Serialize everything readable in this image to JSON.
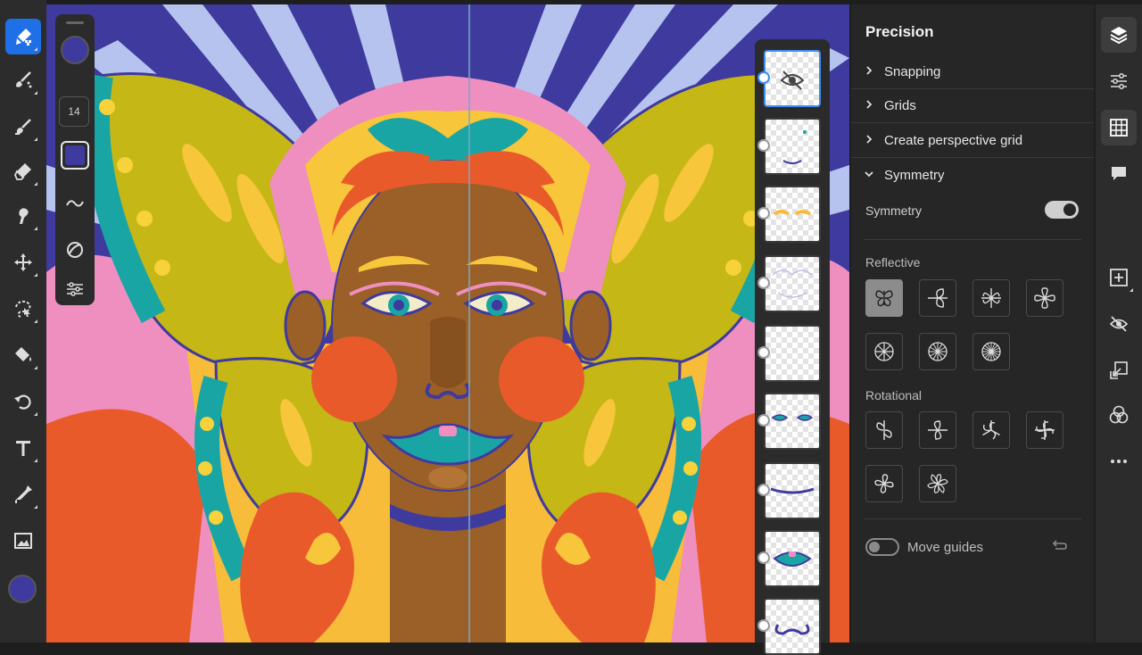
{
  "colors": {
    "accent": "#1f6fe6",
    "current_color": "#3f3a9e",
    "panel_bg": "#262626",
    "toolbar_bg": "#2c2c2c"
  },
  "left_toolbar": {
    "tools": [
      {
        "name": "pixel-brush-icon"
      },
      {
        "name": "live-brush-icon"
      },
      {
        "name": "vector-brush-icon"
      },
      {
        "name": "eraser-icon"
      },
      {
        "name": "smudge-icon"
      },
      {
        "name": "move-icon"
      },
      {
        "name": "lasso-icon"
      },
      {
        "name": "fill-icon"
      },
      {
        "name": "transform-icon"
      },
      {
        "name": "text-icon"
      },
      {
        "name": "eyedropper-icon"
      },
      {
        "name": "image-icon"
      }
    ]
  },
  "brush_panel": {
    "size_value": "14",
    "icons": [
      "smoothing-icon",
      "pressure-icon",
      "brush-settings-icon"
    ]
  },
  "layers_panel": {
    "layers": [
      {
        "name": "layer-eye",
        "hidden": true,
        "selected": true
      },
      {
        "name": "layer-face-details"
      },
      {
        "name": "layer-brows"
      },
      {
        "name": "layer-lines"
      },
      {
        "name": "layer-empty"
      },
      {
        "name": "layer-eyes"
      },
      {
        "name": "layer-mouth-line"
      },
      {
        "name": "layer-lips"
      },
      {
        "name": "layer-nose"
      }
    ]
  },
  "precision_panel": {
    "title": "Precision",
    "sections": {
      "snapping": "Snapping",
      "grids": "Grids",
      "perspective": "Create perspective grid",
      "symmetry": "Symmetry"
    },
    "symmetry_toggle_label": "Symmetry",
    "symmetry_enabled": true,
    "reflective_label": "Reflective",
    "reflective_options": [
      "butterfly-2fold",
      "leaf-horizontal",
      "butterfly-4fold",
      "flower-4fold",
      "radial-8",
      "radial-12",
      "radial-16"
    ],
    "rotational_label": "Rotational",
    "rotational_options": [
      "rot-2fold",
      "rot-leaf",
      "rot-3fold",
      "rot-4fold",
      "rot-5fold",
      "rot-6fold"
    ],
    "move_guides_label": "Move guides",
    "move_guides_enabled": false
  },
  "right_toolbar": {
    "icons": [
      "layers-icon",
      "properties-icon",
      "grid-icon",
      "comments-icon",
      "add-layer-icon",
      "hide-layer-icon",
      "import-icon",
      "blend-icon",
      "more-icon"
    ]
  }
}
